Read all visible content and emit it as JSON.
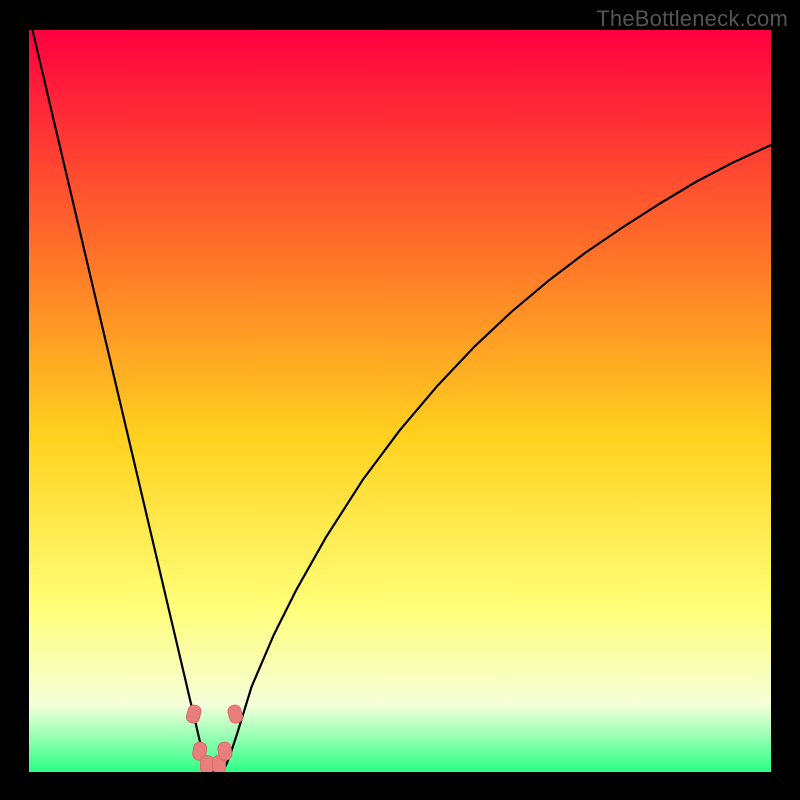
{
  "watermark": "TheBottleneck.com",
  "colors": {
    "frame": "#000000",
    "gradient_top": "#ff0040",
    "gradient_mid1": "#ff6a2a",
    "gradient_mid2": "#ffd21f",
    "gradient_mid3": "#ffff7a",
    "gradient_mid4": "#f5ffda",
    "gradient_bottom": "#2cff87",
    "curve": "#000000",
    "marker_fill": "#e97f7c",
    "marker_stroke": "#d86a67",
    "watermark": "#555555"
  },
  "chart_data": {
    "type": "line",
    "title": "",
    "xlabel": "",
    "ylabel": "",
    "xlim": [
      0,
      100
    ],
    "ylim": [
      0,
      100
    ],
    "legend": false,
    "grid": false,
    "minimum_x": 24,
    "minimum_y": 0,
    "series": [
      {
        "name": "curve",
        "x": [
          0,
          2,
          4,
          6,
          8,
          10,
          12,
          14,
          16,
          18,
          19,
          20,
          21,
          21.5,
          22,
          22.5,
          23,
          23.5,
          24,
          24.5,
          25,
          25.5,
          26,
          26.5,
          27,
          28,
          30,
          33,
          36,
          40,
          45,
          50,
          55,
          60,
          65,
          70,
          75,
          80,
          85,
          90,
          95,
          100
        ],
        "y": [
          102,
          93.5,
          85,
          76.5,
          68,
          59.5,
          51,
          42.5,
          34,
          25.5,
          21.25,
          17,
          12.75,
          10.6,
          8.5,
          6.4,
          4.25,
          2.55,
          0.8,
          0.2,
          0,
          0,
          0.2,
          0.8,
          2.0,
          5.0,
          11.5,
          18.5,
          24.5,
          31.6,
          39.4,
          46.1,
          52.0,
          57.3,
          62.0,
          66.2,
          70.0,
          73.4,
          76.6,
          79.6,
          82.2,
          84.5
        ]
      }
    ],
    "markers": [
      {
        "x": 22.2,
        "y": 7.8
      },
      {
        "x": 23.0,
        "y": 2.8
      },
      {
        "x": 24.0,
        "y": 1.0
      },
      {
        "x": 25.6,
        "y": 1.0
      },
      {
        "x": 26.4,
        "y": 2.8
      },
      {
        "x": 27.8,
        "y": 7.8
      }
    ]
  }
}
